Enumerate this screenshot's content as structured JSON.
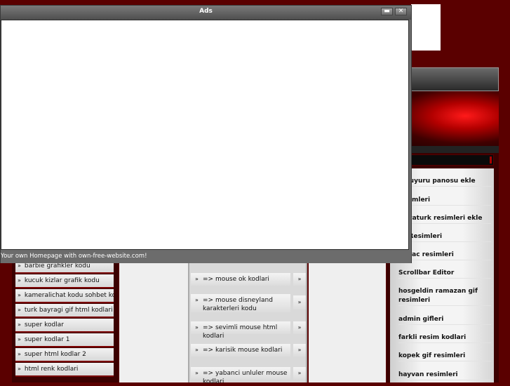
{
  "ads_window": {
    "title": "Ads",
    "minimize_glyph": "▬",
    "close_glyph": "✕",
    "footer_text": "Your own Homepage with own-free-website.com!"
  },
  "left_list": {
    "bullet": "»",
    "items": [
      "barbie grafikler kodu",
      "kucuk kizlar grafik kodu",
      "kameralichat kodu sohbet kodu",
      "turk bayragi gif html kodlari",
      "super kodlar",
      "super kodlar 1",
      "super html kodlar 2",
      "html renk kodlari"
    ]
  },
  "middle_list": {
    "bullet": "»",
    "arrow": "»",
    "items": [
      "=> mouse ok kodlari",
      "=> mouse disneyland karakterleri kodu",
      "=> sevimli mouse html kodlari",
      "=> karisik mouse kodlari",
      "=> yabanci unluler mouse kodlari"
    ]
  },
  "right_list": {
    "items": [
      "e duyuru panosu ekle",
      "resimleri",
      "e ataturk resimleri ekle",
      "ac Resimleri",
      "ayirac resimleri",
      "Scrollbar Editor",
      "hosgeldin ramazan gif resimleri",
      "admin gifleri",
      "farkli resim kodlari",
      "kopek gif resimleri",
      "hayvan resimleri"
    ]
  }
}
